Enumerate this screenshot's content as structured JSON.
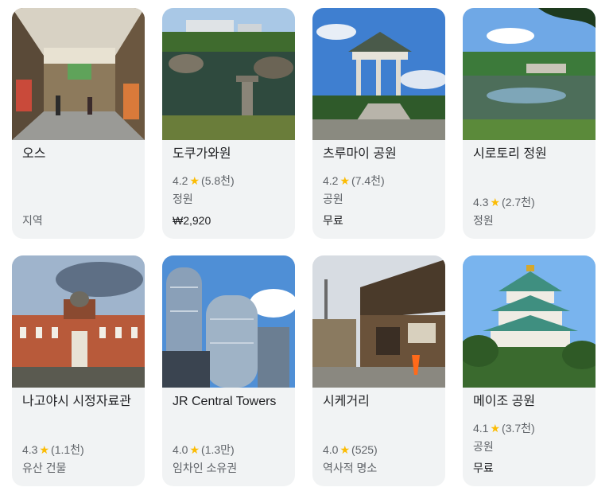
{
  "cards": [
    {
      "name": "오스",
      "rating": "",
      "reviews": "",
      "category": "지역",
      "price": ""
    },
    {
      "name": "도쿠가와원",
      "rating": "4.2",
      "reviews": "(5.8천)",
      "category": "정원",
      "price": "₩2,920"
    },
    {
      "name": "츠루마이 공원",
      "rating": "4.2",
      "reviews": "(7.4천)",
      "category": "공원",
      "price": "무료"
    },
    {
      "name": "시로토리 정원",
      "rating": "4.3",
      "reviews": "(2.7천)",
      "category": "정원",
      "price": ""
    },
    {
      "name": "나고야시 시정자료관",
      "rating": "4.3",
      "reviews": "(1.1천)",
      "category": "유산 건물",
      "price": ""
    },
    {
      "name": "JR Central Towers",
      "rating": "4.0",
      "reviews": "(1.3만)",
      "category": "임차인 소유권",
      "price": ""
    },
    {
      "name": "시케거리",
      "rating": "4.0",
      "reviews": "(525)",
      "category": "역사적 명소",
      "price": ""
    },
    {
      "name": "메이조 공원",
      "rating": "4.1",
      "reviews": "(3.7천)",
      "category": "공원",
      "price": "무료"
    }
  ],
  "star_glyph": "★",
  "colors": {
    "card_bg": "#f1f3f4",
    "title": "#202124",
    "meta": "#5f6368",
    "star": "#fbbc04"
  }
}
